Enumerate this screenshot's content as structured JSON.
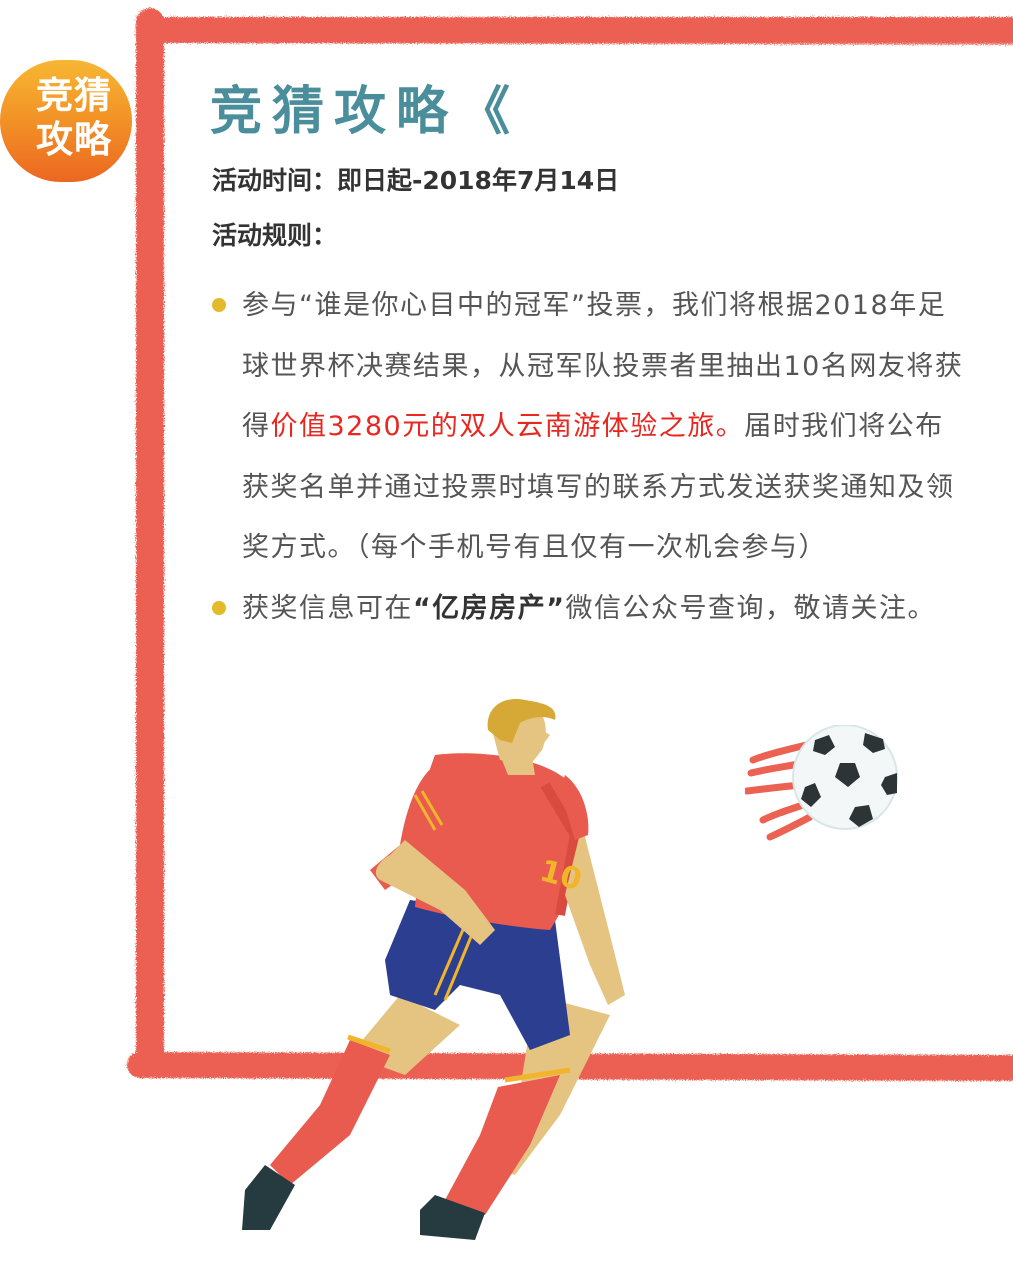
{
  "side_tab": {
    "line1": "竞猜",
    "line2": "攻略"
  },
  "title": "竞猜攻略《",
  "activity_time": "活动时间：即日起-2018年7月14日",
  "rules_label": "活动规则：",
  "rules": [
    {
      "before": "参与“谁是你心目中的冠军”投票，我们将根据2018年足球世界杯决赛结果，从冠军队投票者里抽出10名网友将获得",
      "highlight": "价值3280元的双人云南游体验之旅。",
      "after": "届时我们将公布获奖名单并通过投票时填写的联系方式发送获奖通知及领奖方式。（每个手机号有且仅有一次机会参与）"
    },
    {
      "before": "获奖信息可在",
      "highlight": "“亿房房产”",
      "after": "微信公众号查询，敬请关注。"
    }
  ],
  "player": {
    "jersey_number": "10"
  },
  "colors": {
    "frame": "#eb6152",
    "title": "#4a8d9b",
    "tab_top": "#f7b733",
    "tab_bottom": "#ec6721",
    "bullet": "#e4b92a",
    "highlight": "#e82721",
    "jersey": "#e85b4e",
    "shorts": "#2c3e8f"
  },
  "icons": [
    "bullet-dot-icon",
    "soccer-ball-icon"
  ]
}
